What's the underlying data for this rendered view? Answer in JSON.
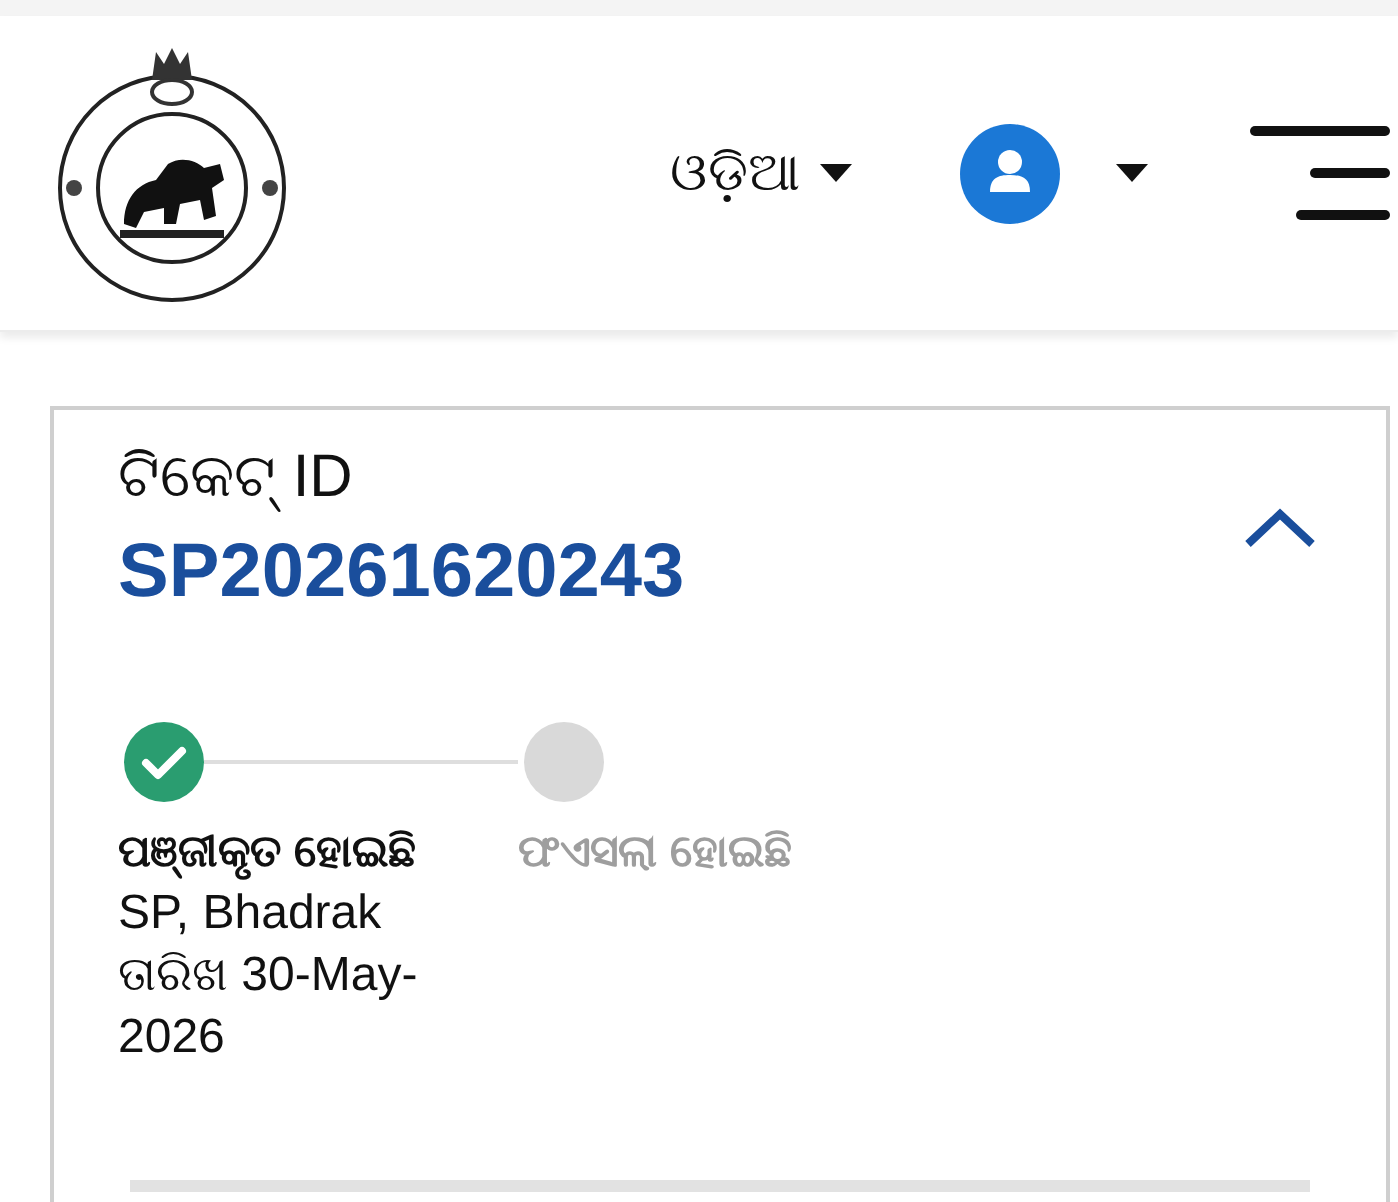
{
  "header": {
    "language_selector": {
      "label": "ଓଡ଼ିଆ"
    }
  },
  "ticket": {
    "label": "ଟିକେଟ୍ ID",
    "id": "SP20261620243",
    "expanded": true
  },
  "steps": [
    {
      "title": "ପଞ୍ଜୀକୃତ ହୋଇଛି",
      "completed": true,
      "details": [
        "SP, Bhadrak",
        "ତାରିଖ 30-May-2026"
      ]
    },
    {
      "title": "ଫଏସଲା ହୋଇଛି",
      "completed": false
    }
  ]
}
